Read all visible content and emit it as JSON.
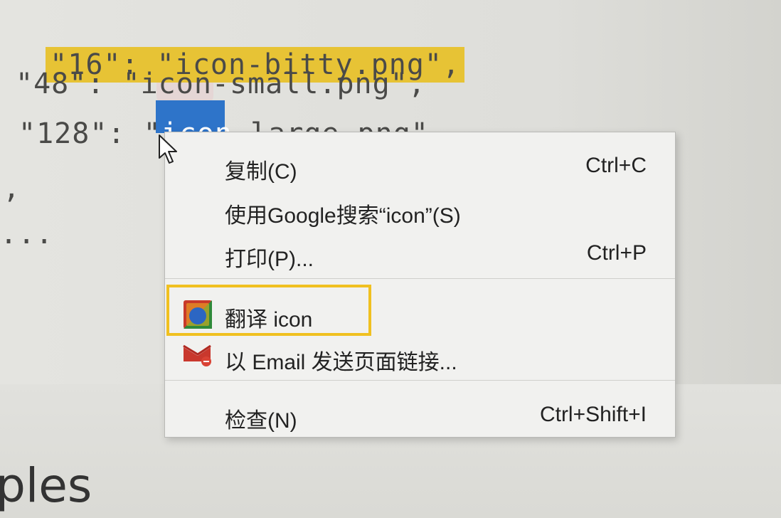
{
  "code": {
    "line1": "\"16\": \"icon-bitty.png\",",
    "line2": "\"48\": \"icon-small.png\",",
    "line3_prefix": "\"128\": \"",
    "line3_selected": "icon",
    "line3_suffix": "-large.png\"",
    "line4": ",",
    "line5": "..."
  },
  "heading_fragment": "ples",
  "context_menu": {
    "items": [
      {
        "label": "复制(C)",
        "shortcut": "Ctrl+C"
      },
      {
        "label": "使用Google搜索“icon”(S)",
        "shortcut": ""
      },
      {
        "label": "打印(P)...",
        "shortcut": "Ctrl+P"
      },
      {
        "label": "翻译 icon",
        "shortcut": "",
        "icon": "translate-icon"
      },
      {
        "label": "以 Email 发送页面链接...",
        "shortcut": "",
        "icon": "email-icon"
      },
      {
        "label": "检查(N)",
        "shortcut": "Ctrl+Shift+I"
      }
    ]
  },
  "colors": {
    "highlight": "#e7c335",
    "selection": "#2e74c9",
    "focus_border": "#f0c020"
  }
}
